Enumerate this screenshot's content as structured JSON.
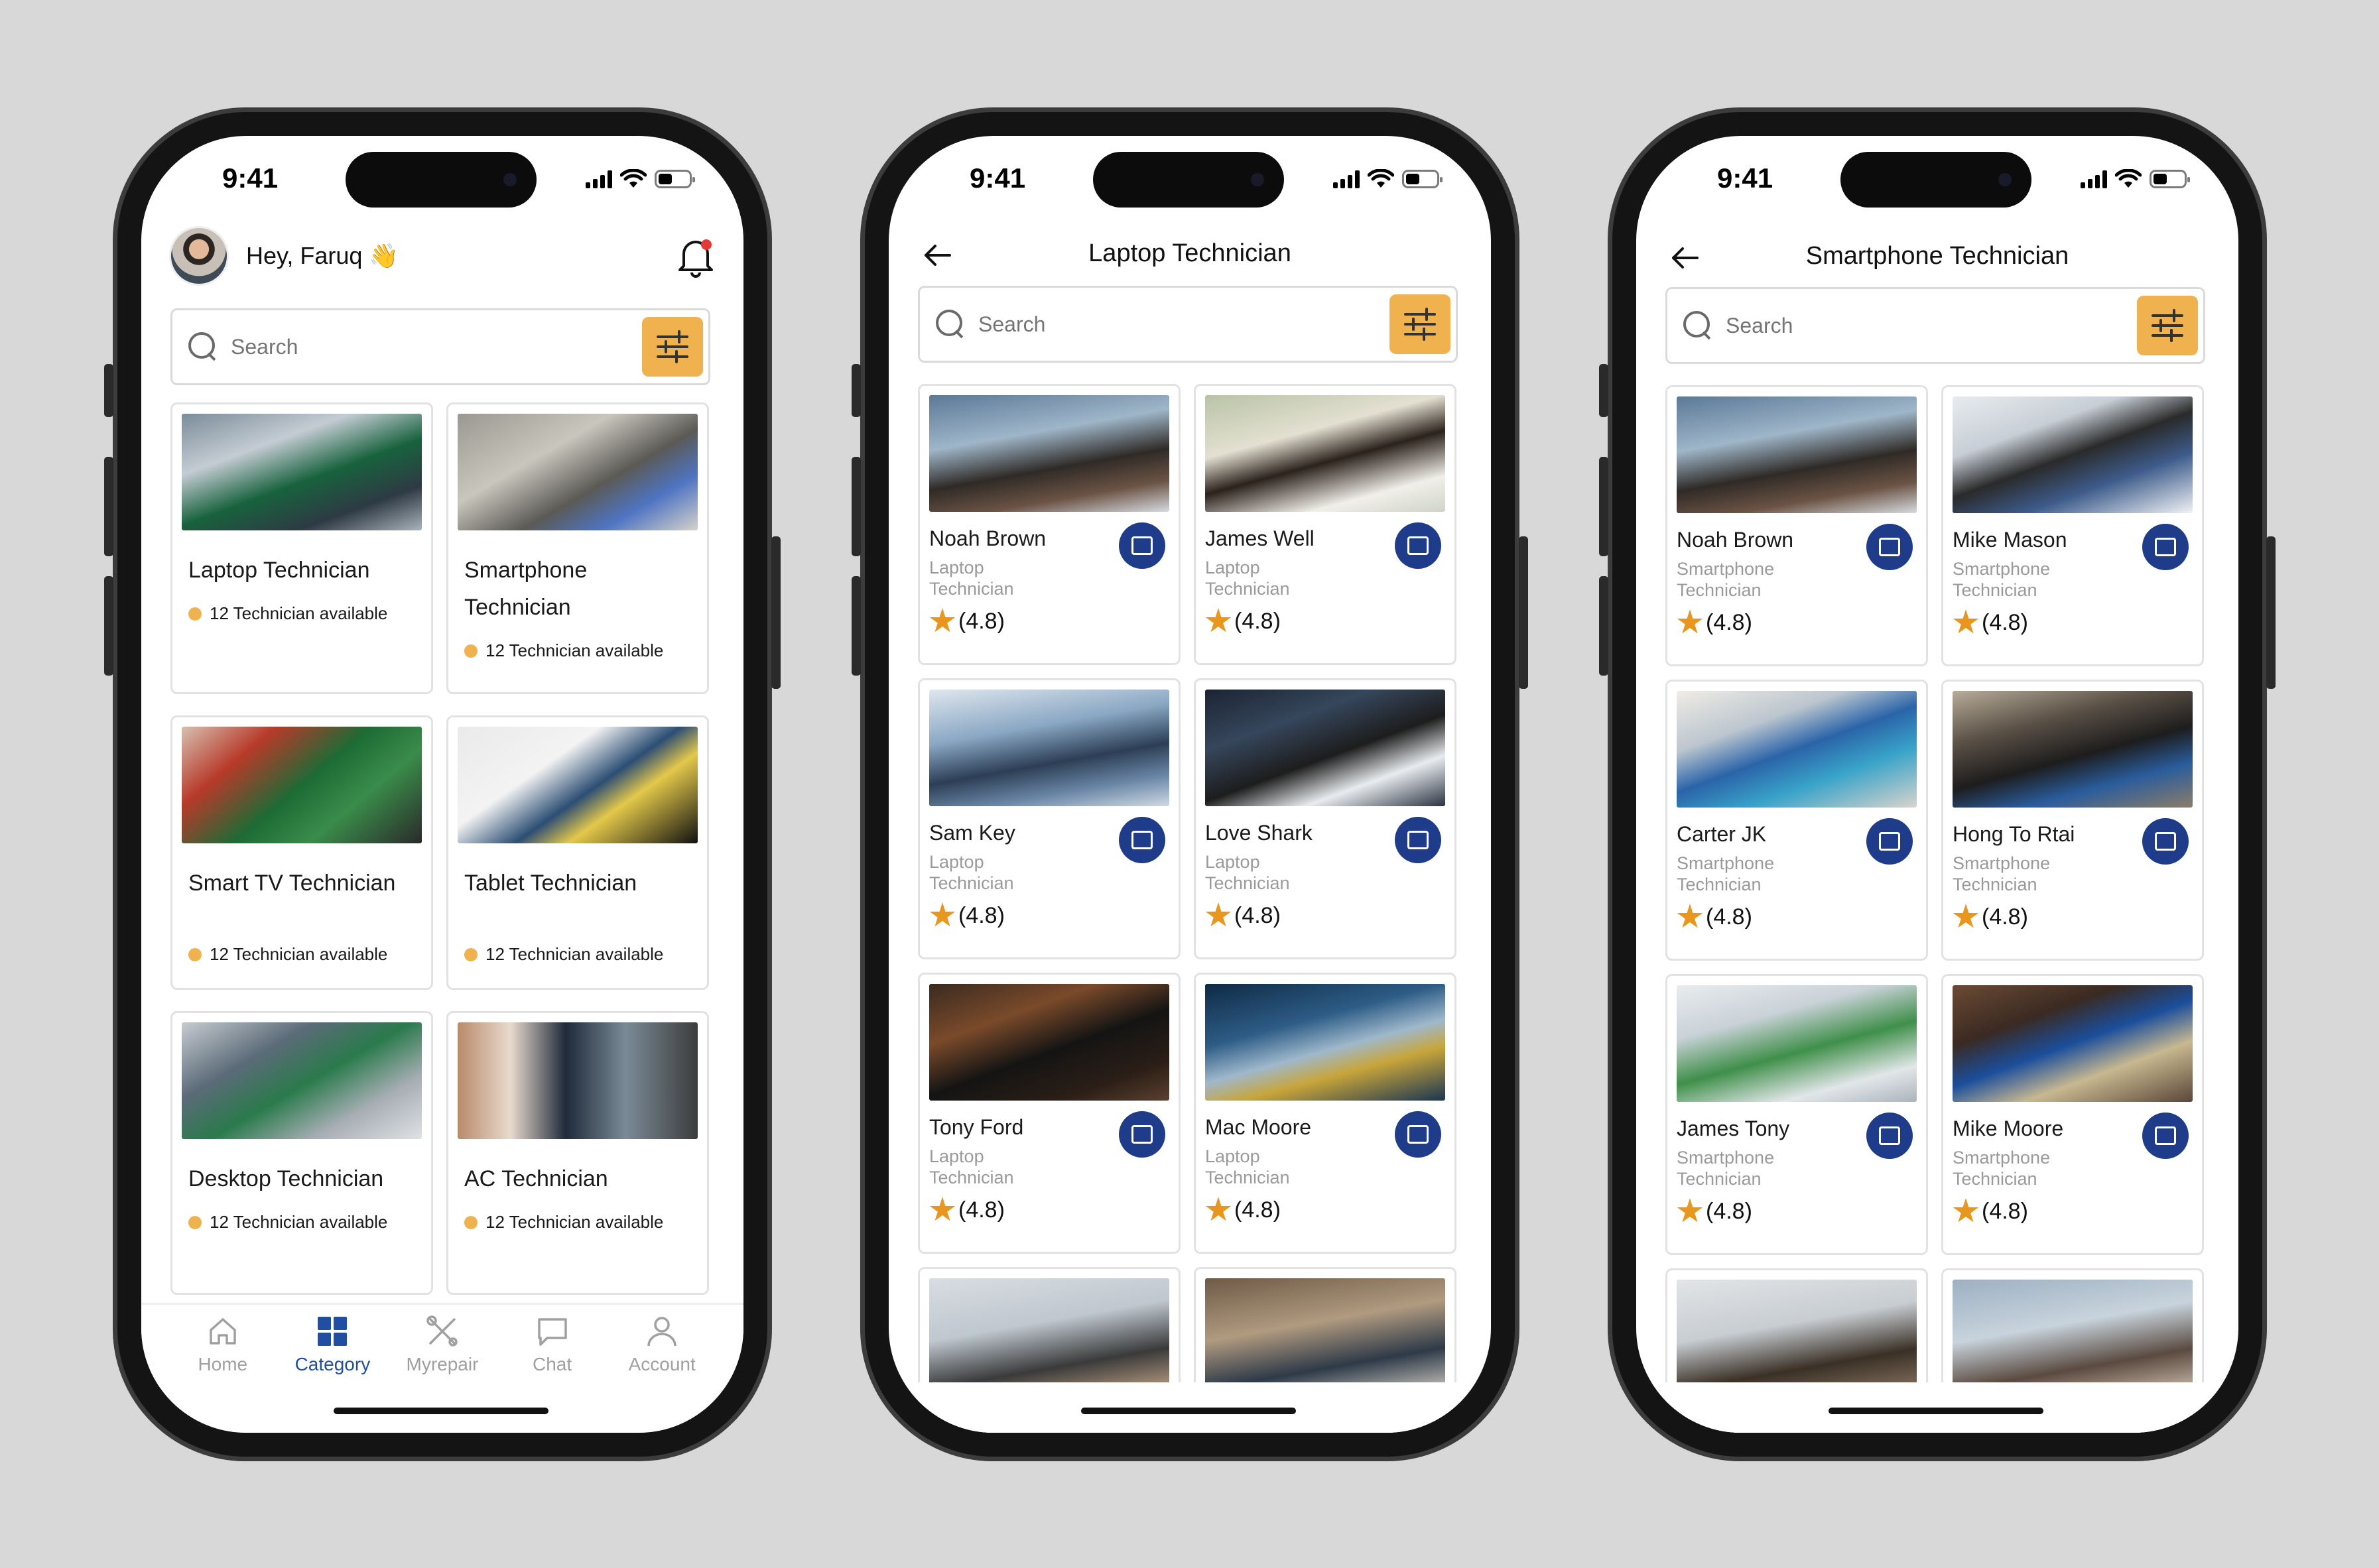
{
  "status_bar": {
    "time": "9:41"
  },
  "screen1": {
    "greeting": "Hey, Faruq",
    "greeting_emoji": "👋",
    "search_placeholder": "Search",
    "categories": [
      {
        "title": "Laptop Technician",
        "available": "12 Technician available"
      },
      {
        "title": "Smartphone Technician",
        "available": "12 Technician available"
      },
      {
        "title": "Smart TV Technician",
        "available": "12 Technician available"
      },
      {
        "title": "Tablet Technician",
        "available": "12 Technician available"
      },
      {
        "title": "Desktop Technician",
        "available": "12 Technician available"
      },
      {
        "title": "AC Technician",
        "available": "12 Technician available"
      }
    ],
    "tabs": [
      {
        "label": "Home",
        "icon": "home-icon",
        "active": false
      },
      {
        "label": "Category",
        "icon": "grid-icon",
        "active": true
      },
      {
        "label": "Myrepair",
        "icon": "tools-icon",
        "active": false
      },
      {
        "label": "Chat",
        "icon": "chat-icon",
        "active": false
      },
      {
        "label": "Account",
        "icon": "user-icon",
        "active": false
      }
    ]
  },
  "screen2": {
    "title": "Laptop Technician",
    "search_placeholder": "Search",
    "technicians": [
      {
        "name": "Noah Brown",
        "role": "Laptop Technician",
        "rating": "(4.8)"
      },
      {
        "name": "James Well",
        "role": "Laptop Technician",
        "rating": "(4.8)"
      },
      {
        "name": "Sam Key",
        "role": "Laptop Technician",
        "rating": "(4.8)"
      },
      {
        "name": "Love Shark",
        "role": "Laptop Technician",
        "rating": "(4.8)"
      },
      {
        "name": "Tony Ford",
        "role": "Laptop Technician",
        "rating": "(4.8)"
      },
      {
        "name": "Mac Moore",
        "role": "Laptop Technician",
        "rating": "(4.8)"
      }
    ]
  },
  "screen3": {
    "title": "Smartphone Technician",
    "search_placeholder": "Search",
    "technicians": [
      {
        "name": "Noah Brown",
        "role": "Smartphone Technician",
        "rating": "(4.8)"
      },
      {
        "name": "Mike Mason",
        "role": "Smartphone Technician",
        "rating": "(4.8)"
      },
      {
        "name": "Carter JK",
        "role": "Smartphone Technician",
        "rating": "(4.8)"
      },
      {
        "name": "Hong To Rtai",
        "role": "Smartphone Technician",
        "rating": "(4.8)"
      },
      {
        "name": "James Tony",
        "role": "Smartphone Technician",
        "rating": "(4.8)"
      },
      {
        "name": "Mike Moore",
        "role": "Smartphone Technician",
        "rating": "(4.8)"
      }
    ]
  },
  "colors": {
    "accent": "#f0b24f",
    "primary": "#1e3c8a",
    "active_tab": "#1f4ea3",
    "background": "#d8d8d8"
  }
}
